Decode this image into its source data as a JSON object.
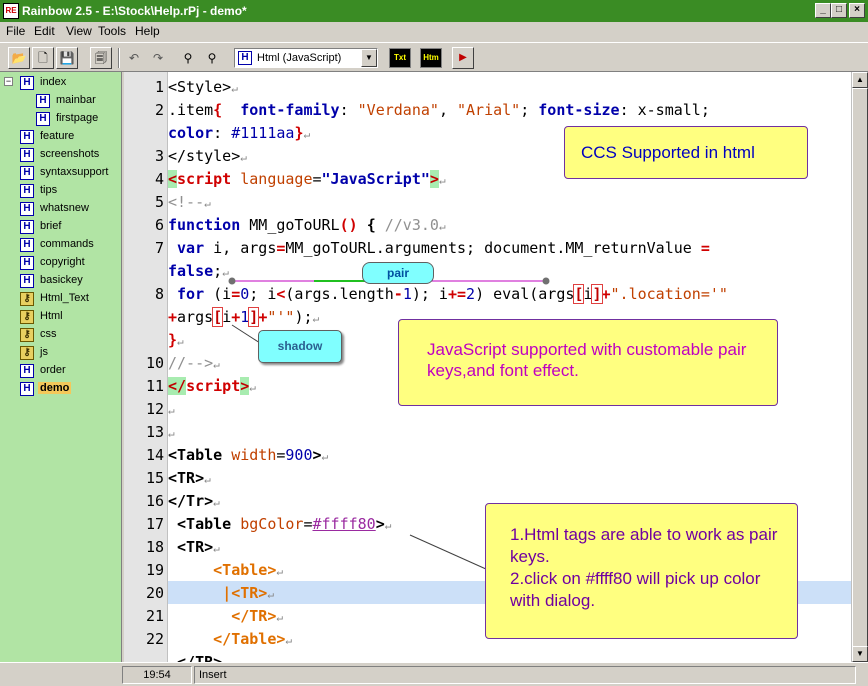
{
  "window": {
    "title": "Rainbow 2.5 - E:\\Stock\\Help.rPj - demo*",
    "app_icon": "RE",
    "min": "_",
    "max": "□",
    "close": "×"
  },
  "menu": [
    "File",
    "Edit",
    "View",
    "Tools",
    "Help"
  ],
  "toolbar": {
    "language_select": "Html (JavaScript)",
    "txt_label": "Txt",
    "htm_label": "Htm"
  },
  "tree": {
    "items": [
      {
        "label": "index",
        "type": "html"
      },
      {
        "label": "mainbar",
        "type": "html"
      },
      {
        "label": "firstpage",
        "type": "html"
      },
      {
        "label": "feature",
        "type": "html"
      },
      {
        "label": "screenshots",
        "type": "html"
      },
      {
        "label": "syntaxsupport",
        "type": "html"
      },
      {
        "label": "tips",
        "type": "html"
      },
      {
        "label": "whatsnew",
        "type": "html"
      },
      {
        "label": "brief",
        "type": "html"
      },
      {
        "label": "commands",
        "type": "html"
      },
      {
        "label": "copyright",
        "type": "html"
      },
      {
        "label": "basickey",
        "type": "html"
      },
      {
        "label": "Html_Text",
        "type": "key"
      },
      {
        "label": "Html",
        "type": "key"
      },
      {
        "label": "css",
        "type": "key"
      },
      {
        "label": "js",
        "type": "key"
      },
      {
        "label": "order",
        "type": "html"
      },
      {
        "label": "demo",
        "type": "html",
        "selected": true
      }
    ]
  },
  "editor": {
    "line_numbers": [
      "1",
      "2",
      "",
      "3",
      "4",
      "5",
      "6",
      "7",
      "",
      "8",
      "",
      "",
      "10",
      "11",
      "12",
      "13",
      "14",
      "15",
      "16",
      "17",
      "18",
      "19",
      "20",
      "21",
      "22"
    ],
    "current_line": "20"
  },
  "annotations": {
    "css_note": "CCS Supported in html",
    "js_note": "JavaScript supported with customable pair keys,and font effect.",
    "html_note_1": "1.Html tags are able to work as pair keys.",
    "html_note_2": "2.click on #ffff80 will  pick up color with dialog.",
    "pair_label": "pair",
    "shadow_label": "shadow"
  },
  "status": {
    "position": "19:54",
    "mode": "Insert"
  },
  "colors": {
    "title_bar": "#3a8c24",
    "sidebar": "#b1e4a4",
    "note": "#ffff80",
    "pill": "#80ffff",
    "current_line": "#cce0f8"
  }
}
